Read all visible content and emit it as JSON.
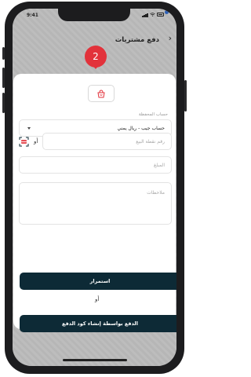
{
  "status_bar": {
    "time": "9:41"
  },
  "header": {
    "title": "دفع مشتريات"
  },
  "step_badge": "2",
  "wallet": {
    "label": "حساب المحفظة",
    "value": "حساب جيب - ريال يمني"
  },
  "pos": {
    "placeholder": "رقم نقطة البيع",
    "or": "أو"
  },
  "amount": {
    "placeholder": "المبلغ"
  },
  "notes": {
    "placeholder": "ملاحظات"
  },
  "actions": {
    "continue": "استمرار",
    "or": "أو",
    "generate_code": "الدفع بواسطة إنشاء كود الدفع"
  },
  "colors": {
    "primary": "#0d2a36",
    "badge": "#e2323b",
    "accent": "#e2323b"
  }
}
